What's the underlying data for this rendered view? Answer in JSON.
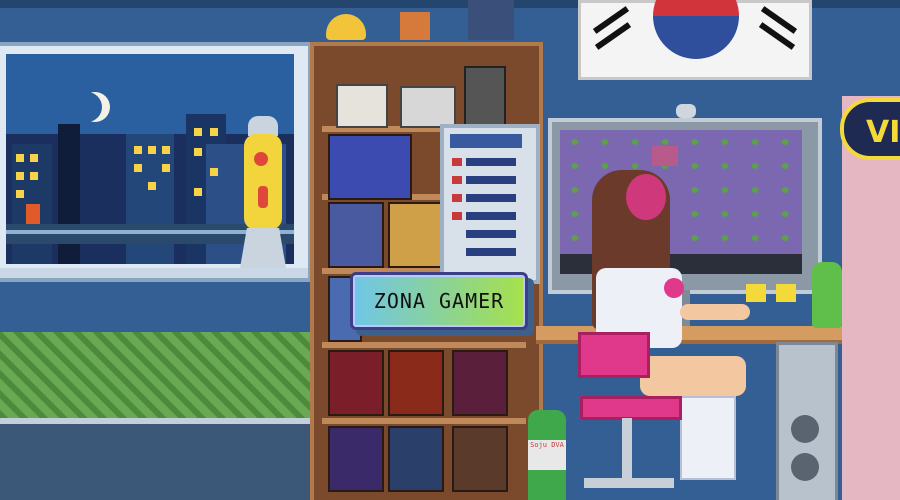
{
  "scene": {
    "label_text": "ZONA GAMER",
    "sign_text": "VI",
    "bottle_text": "Soju DVA",
    "colors": {
      "wall": "#335f94",
      "shelf_wood": "#7b4a2c",
      "label_gradient_start": "#6fc6e8",
      "label_gradient_end": "#a6e14a",
      "chair_pink": "#e0388a",
      "monitor_frame": "#c2ccd6"
    }
  }
}
